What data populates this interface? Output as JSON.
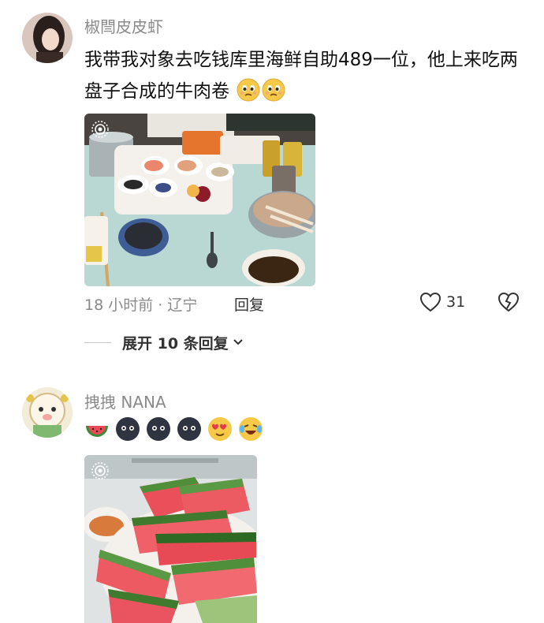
{
  "comments": [
    {
      "username": "椒閆皮皮虾",
      "text": "我带我对象去吃钱库里海鲜自助489一位，他上来吃两盘子合成的牛肉卷",
      "text_emojis": [
        "worried-face-emoji",
        "worried-face-emoji"
      ],
      "photo_alt": "seafood buffet table",
      "timestamp": "18 小时前 · 辽宁",
      "reply_label": "回复",
      "like_count": "31",
      "expand_label": "展开 10 条回复"
    },
    {
      "username": "拽拽 NANA",
      "reaction_emojis": [
        "watermelon-emoji",
        "dark-face-emoji",
        "dark-face-emoji",
        "dark-face-emoji",
        "heart-eyes-emoji",
        "laughing-crying-emoji"
      ],
      "photo_alt": "plate of watermelon slices"
    }
  ],
  "colors": {
    "username": "#8a8a8a",
    "text": "#111111",
    "meta": "#8a8a8a",
    "accent": "#333333"
  }
}
